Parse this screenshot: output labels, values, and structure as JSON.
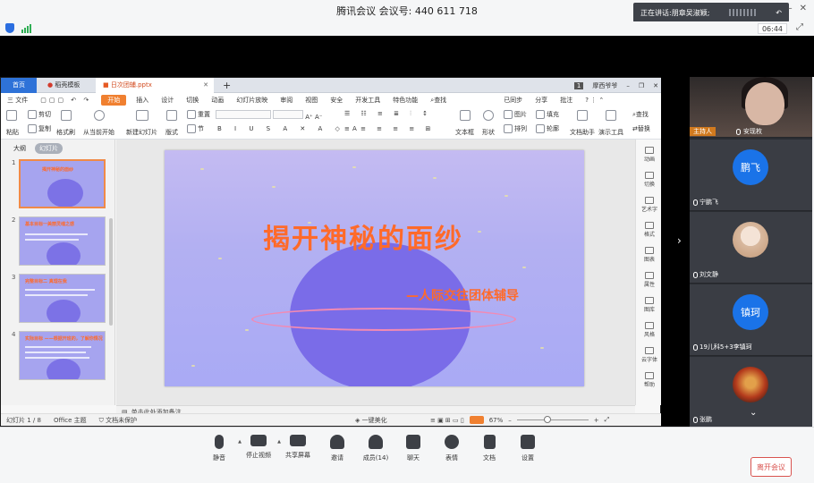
{
  "titlebar": {
    "app": "腾讯会议",
    "meeting_label": "会议号:",
    "meeting_id": "440 611 718"
  },
  "speaking": {
    "prefix": "正在讲话:",
    "names": "朋章吴淑颖;"
  },
  "timer": "06:44",
  "wps": {
    "tabs": {
      "home": "首页",
      "daoke": "稻壳模板",
      "file": "日次团辅.pptx",
      "plus": "+"
    },
    "tab_right": {
      "badge": "1",
      "user": "摩西爷爷"
    },
    "menu": {
      "file": "三 文件",
      "items": [
        "开始",
        "插入",
        "设计",
        "切换",
        "动画",
        "幻灯片放映",
        "审阅",
        "视图",
        "安全",
        "开发工具",
        "特色功能"
      ],
      "search": "查找",
      "right": [
        "已同步",
        "分享",
        "批注"
      ]
    },
    "ribbon": {
      "paste": "粘贴",
      "cut": "剪切",
      "copy": "复制",
      "format_painter": "格式刷",
      "from_current": "从当前开始",
      "new_slide": "新建幻灯片",
      "layout": "版式",
      "section": "节",
      "reset": "重置",
      "textbox": "文本框",
      "shape": "形状",
      "arrange": "排列",
      "picture": "图片",
      "fill": "填充",
      "outline": "轮廓",
      "doc_assistant": "文档助手",
      "present_tools": "演示工具",
      "find": "查找",
      "replace": "替换"
    },
    "left_tabs": {
      "outline": "大纲",
      "slides": "幻灯片"
    },
    "thumbs": [
      {
        "num": "1",
        "title": "揭开神秘的面纱"
      },
      {
        "num": "2",
        "title": "基本目标一美丽灵魂之感"
      },
      {
        "num": "3",
        "title": "完整目标二 真理在我"
      },
      {
        "num": "4",
        "title": "实际目标 ——根据开班的，了解你情况"
      }
    ],
    "slide": {
      "title": "揭开神秘的面纱",
      "subtitle": "—人际交往团体辅导"
    },
    "right_panel": [
      "动画",
      "切换",
      "艺术字",
      "格式",
      "图表",
      "属性",
      "图库",
      "风格",
      "云字体",
      "帮助"
    ],
    "notes": "单击此处添加备注",
    "status": {
      "slide_count": "幻灯片 1 / 8",
      "theme": "Office 主题",
      "protect": "文档未保护",
      "beautify": "一键美化",
      "zoom": "67%"
    }
  },
  "participants": {
    "host": {
      "badge": "主持人",
      "name": "安现枚"
    },
    "people": [
      {
        "avatar": "鹏飞",
        "name": "宁鹏飞",
        "color": "#1a73e8"
      },
      {
        "avatar": "",
        "name": "刘文静",
        "color": "#e2c9b8"
      },
      {
        "avatar": "镇珂",
        "name": "19儿科5+3李镇珂",
        "color": "#1a73e8"
      },
      {
        "avatar": "",
        "name": "张鹏",
        "color": "#b33a1c"
      }
    ]
  },
  "toolbar": {
    "buttons": [
      "静音",
      "停止视频",
      "共享屏幕",
      "邀请",
      "成员(14)",
      "聊天",
      "表情",
      "文档",
      "设置"
    ],
    "leave": "离开会议"
  }
}
